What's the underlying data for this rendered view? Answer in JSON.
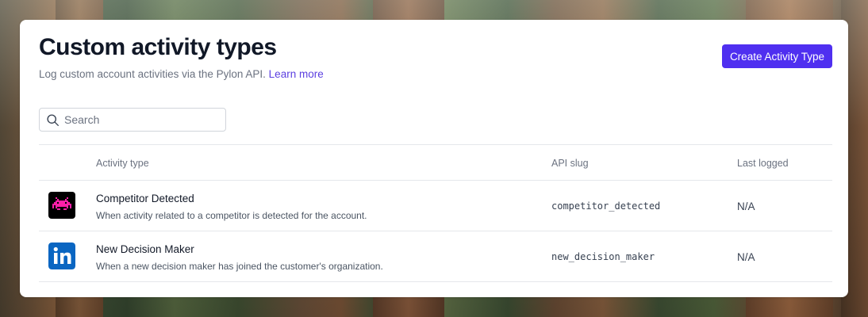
{
  "page": {
    "title": "Custom activity types",
    "subtitle": "Log custom account activities via the Pylon API.",
    "learn_more": "Learn more",
    "create_button": "Create Activity Type"
  },
  "search": {
    "placeholder": "Search",
    "value": ""
  },
  "table": {
    "columns": [
      "Activity type",
      "API slug",
      "Last logged"
    ],
    "rows": [
      {
        "icon": "space-invader-icon",
        "name": "Competitor Detected",
        "description": "When activity related to a competitor is detected for the account.",
        "slug": "competitor_detected",
        "last_logged": "N/A"
      },
      {
        "icon": "linkedin-icon",
        "name": "New Decision Maker",
        "description": "When a new decision maker has joined the customer's organization.",
        "slug": "new_decision_maker",
        "last_logged": "N/A"
      }
    ]
  },
  "colors": {
    "accent": "#4f2ff0",
    "link": "#5b3fe0",
    "invader": "#ff1fa8",
    "linkedin": "#0a66c2"
  }
}
